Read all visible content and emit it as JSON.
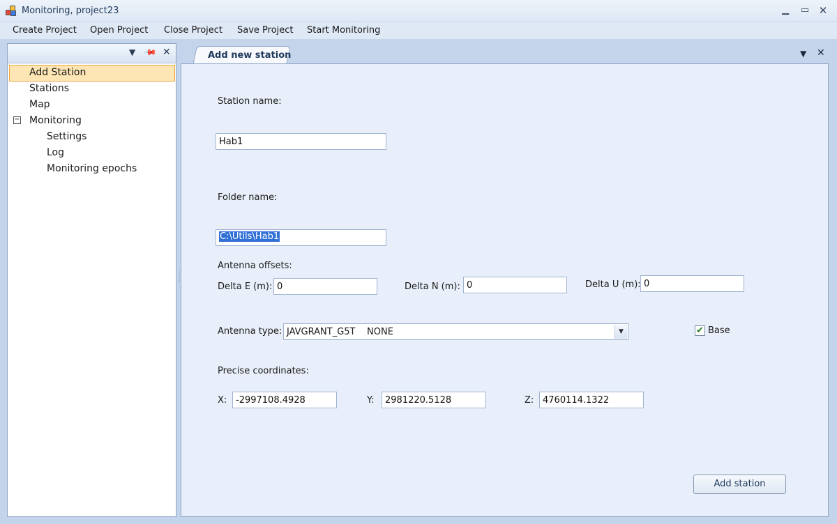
{
  "window": {
    "title": "Monitoring, project23"
  },
  "menu": {
    "items": [
      "Create Project",
      "Open Project",
      "Close Project",
      "Save Project",
      "Start Monitoring"
    ]
  },
  "tree": {
    "items": [
      {
        "label": "Add Station",
        "selected": true
      },
      {
        "label": "Stations"
      },
      {
        "label": "Map"
      },
      {
        "label": "Monitoring",
        "expanded": true
      },
      {
        "label": "Settings"
      },
      {
        "label": "Log"
      },
      {
        "label": "Monitoring epochs"
      }
    ]
  },
  "tab": {
    "label": "Add new station"
  },
  "form": {
    "station_name_label": "Station name:",
    "station_name_value": "Hab1",
    "folder_name_label": "Folder name:",
    "folder_name_value": "C:\\Utils\\Hab1",
    "antenna_offsets_label": "Antenna offsets:",
    "delta_e_label": "Delta E (m):",
    "delta_e_value": "0",
    "delta_n_label": "Delta N (m):",
    "delta_n_value": "0",
    "delta_u_label": "Delta U (m):",
    "delta_u_value": "0",
    "antenna_type_label": "Antenna type:",
    "antenna_type_value": "JAVGRANT_G5T    NONE",
    "base_label": "Base",
    "base_checked": true,
    "precise_coordinates_label": "Precise coordinates:",
    "x_label": "X:",
    "x_value": "-2997108.4928",
    "y_label": "Y:",
    "y_value": "2981220.5128",
    "z_label": "Z:",
    "z_value": "4760114.1322",
    "add_station_button": "Add station"
  },
  "icons": {
    "checkmark": "✔",
    "dropdown": "▼",
    "close": "✕",
    "pin": "✎"
  },
  "colors": {
    "selection_bg": "#fde5b4",
    "selection_border": "#e8a43c",
    "text_selection": "#3170d6",
    "panel_bg": "#e9effa"
  }
}
